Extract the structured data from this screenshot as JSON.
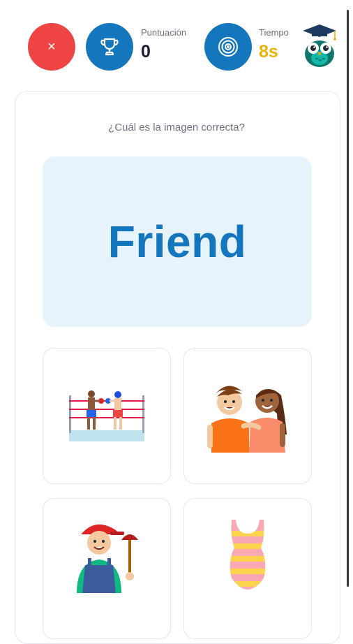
{
  "header": {
    "close_label": "×",
    "score_label": "Puntuación",
    "score_value": "0",
    "time_label": "Tiempo",
    "time_value": "8s"
  },
  "quiz": {
    "prompt": "¿Cuál es la imagen correcta?",
    "word": "Friend",
    "options": [
      {
        "icon": "boxing-match-icon"
      },
      {
        "icon": "two-friends-icon"
      },
      {
        "icon": "plumber-icon"
      },
      {
        "icon": "swimsuit-icon"
      }
    ]
  },
  "colors": {
    "close": "#ef4444",
    "brand_blue": "#1477be",
    "time": "#eab308",
    "word_box": "#e6f3fb"
  }
}
